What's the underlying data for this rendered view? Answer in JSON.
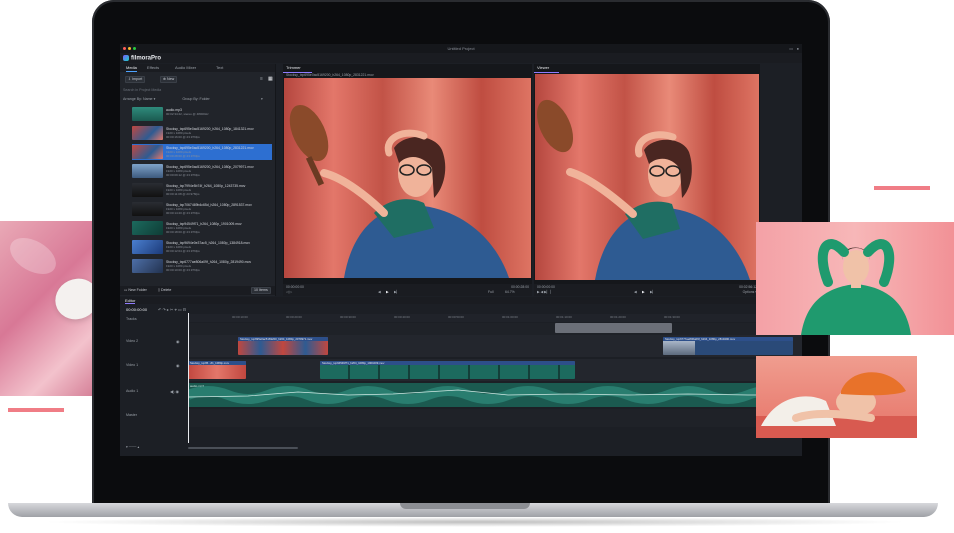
{
  "window": {
    "title": "Untitled Project"
  },
  "app": {
    "name": "filmoraPro"
  },
  "colors": {
    "accent": "#4ea3ff",
    "selection": "#2d6fd1",
    "brand_pink": "#f07d86"
  },
  "left_panel": {
    "tabs": [
      {
        "label": "Media",
        "active": true
      },
      {
        "label": "Effects",
        "active": false
      },
      {
        "label": "Audio Mixer",
        "active": false
      },
      {
        "label": "Text",
        "active": false
      }
    ],
    "import_label": "Import",
    "new_label": "New",
    "search_placeholder": "Search in Project Media",
    "arrange_label": "Arrange By: Name",
    "group_label": "Group By: Folder",
    "items": [
      {
        "name": "audio.mp3",
        "meta": "00:02:34:22, stereo @ 48000Hz",
        "thumb": "audio",
        "selected": false
      },
      {
        "name": "Stocksy_txp695e0ac5169200_h264_1080p_1841321.mov",
        "meta": "1920 x 1080 pixels\n00:00:16:00 @ 23.976fps",
        "thumb": "red",
        "selected": false
      },
      {
        "name": "Stocksy_txp695e0ac5169200_h264_1080p_2831221.mov",
        "meta": "1920 x 1080 pixels\n00:00:28:00 @ 23.976fps",
        "thumb": "red",
        "selected": true
      },
      {
        "name": "Stocksy_txp695e0ac5169200_h264_1080p_2079971.mov",
        "meta": "1920 x 1080 pixels\n00:00:09:12 @ 23.976fps",
        "thumb": "car",
        "selected": false
      },
      {
        "name": "Stocksy_txp7994e5b74f_h264_1080p_1243735.mov",
        "meta": "1920 x 1080 pixels\n00:00:11:08 @ 23.976fps",
        "thumb": "dark",
        "selected": false
      },
      {
        "name": "Stocksy_txp7067469b4c65d_h264_1080p_2891537.mov",
        "meta": "1920 x 1080 pixels\n00:00:14:20 @ 23.976fps",
        "thumb": "dark",
        "selected": false
      },
      {
        "name": "Stocksy_txp94549f71_h264_1080p_1901009.mov",
        "meta": "1920 x 1080 pixels\n00:00:18:00 @ 23.976fps",
        "thumb": "teal",
        "selected": false
      },
      {
        "name": "Stocksy_txp9694e0e37ac5_h264_1080p_1384918.mov",
        "meta": "1920 x 1080 pixels\n00:00:12:04 @ 23.976fps",
        "thumb": "blue",
        "selected": false
      },
      {
        "name": "Stocksy_txp6777ae806a09f_h264_1080p_2819490.mov",
        "meta": "1920 x 1080 pixels\n00:00:10:00 @ 23.976fps",
        "thumb": "street",
        "selected": false
      }
    ],
    "new_folder_label": "New Folder",
    "delete_label": "Delete",
    "count_label": "10 Items"
  },
  "trimmer": {
    "tab_label": "Trimmer",
    "filename": "Stocksy_txp695e0ac5169200_h264_1080p_2831221.mov",
    "timecode_left": "00:00:00:00",
    "timecode_right": "00:00:28:00",
    "zoom": "Full",
    "fit": "64.7%"
  },
  "viewer": {
    "tab_label": "Viewer",
    "timecode_left": "00:00:00:00",
    "timecode_right": "00:02:56:12",
    "options_label": "Options"
  },
  "timeline": {
    "tab_label": "Editor",
    "timecode": "00:00:00:00",
    "ruler": [
      "00:00:10:00",
      "00:00:20:00",
      "00:00:30:00",
      "00:00:40:00",
      "00:00:50:00",
      "00:01:00:00",
      "00:01:10:00",
      "00:01:20:00",
      "00:01:30:00"
    ],
    "tracks": [
      {
        "label": "Tracks"
      },
      {
        "label": "Video 2"
      },
      {
        "label": "Video 1"
      },
      {
        "label": "Audio 1"
      },
      {
        "label": "Master"
      }
    ],
    "clips": {
      "v2_a": "Stocksy_txp695e0ac5169200_h264_1080p_2079971.mov",
      "v2_b": "Stocksy_txp6777ae806a09f_h264_1080p_2819490.mov",
      "v1_a": "Stocksy_txp95...#1_1080p.mov",
      "v1_b": "Stocksy_txp94549f71_h264_1080p_1901009.mov",
      "a1": "audio.mp3"
    }
  }
}
